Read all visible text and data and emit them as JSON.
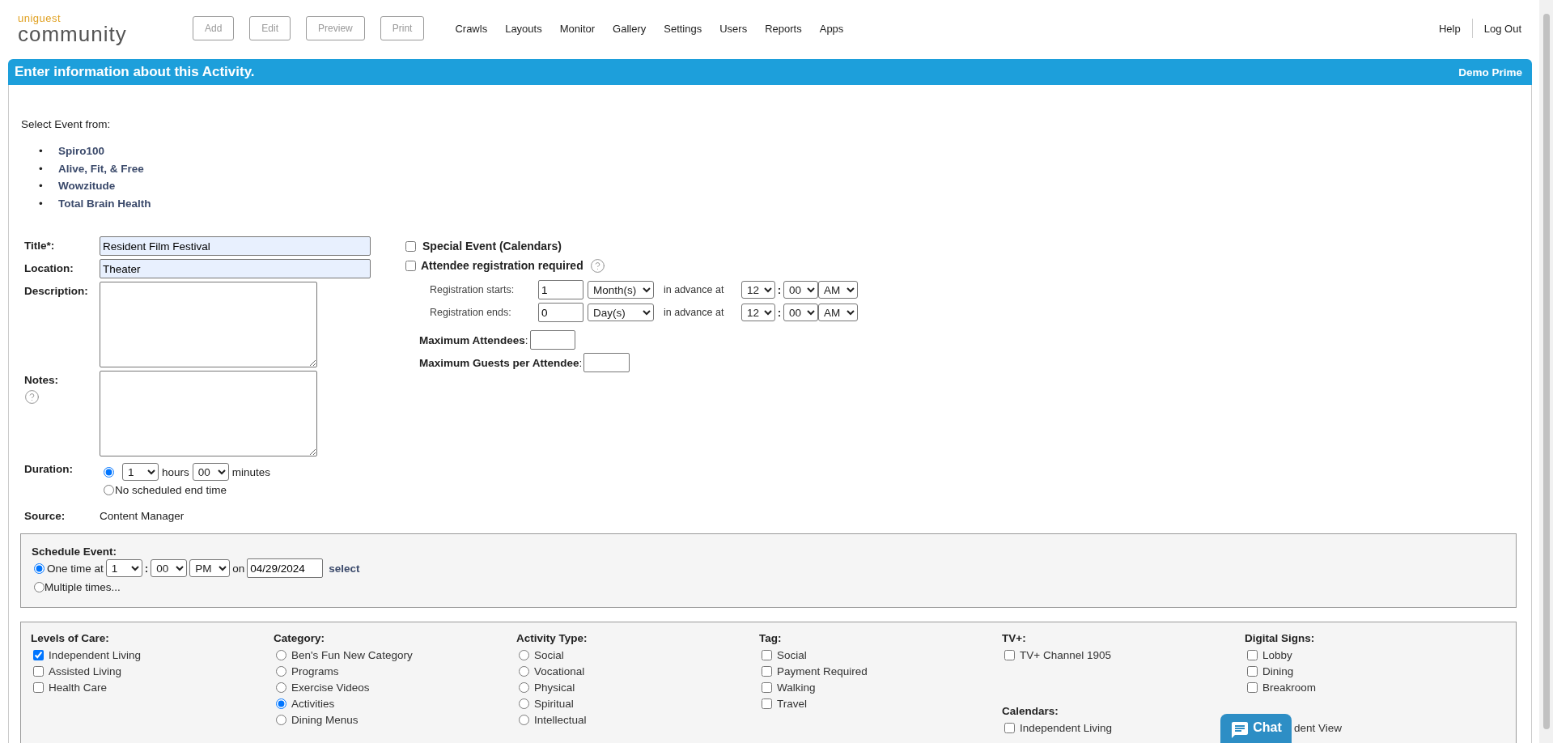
{
  "header": {
    "logo": {
      "top": "uniguest",
      "bottom": "community"
    },
    "actions": [
      {
        "label": "Add",
        "disabled": true
      },
      {
        "label": "Edit",
        "disabled": true
      },
      {
        "label": "Preview",
        "disabled": true
      },
      {
        "label": "Print",
        "disabled": true
      }
    ],
    "nav": [
      "Crawls",
      "Layouts",
      "Monitor",
      "Gallery",
      "Settings",
      "Users",
      "Reports",
      "Apps"
    ],
    "account_links": [
      "Help",
      "Log Out"
    ]
  },
  "banner": {
    "title": "Enter information about this Activity.",
    "account": "Demo Prime"
  },
  "select_event": {
    "label": "Select Event from:",
    "items": [
      {
        "marker": "•",
        "label": "Spiro100"
      },
      {
        "marker": "•",
        "label": "Alive, Fit, & Free"
      },
      {
        "marker": "•",
        "label": "Wowzitude"
      },
      {
        "marker": "•",
        "label": "Total Brain Health"
      }
    ]
  },
  "form": {
    "title": {
      "label": "Title*:",
      "value": "Resident Film Festival"
    },
    "location": {
      "label": "Location:",
      "value": "Theater"
    },
    "description": {
      "label": "Description:"
    },
    "notes": {
      "label": "Notes:"
    },
    "duration": {
      "label": "Duration:",
      "options": [
        {
          "kind": "timed",
          "selected": true,
          "hours": "1",
          "hours_unit": "hours",
          "minutes": "00",
          "minutes_unit": "minutes"
        },
        {
          "kind": "open",
          "selected": false,
          "label": "No scheduled end time"
        }
      ]
    },
    "source": {
      "label": "Source:",
      "value": "Content Manager"
    }
  },
  "registration": {
    "special_event": {
      "label": "Special Event (Calendars)",
      "checked": false
    },
    "required": {
      "label": "Attendee registration required",
      "checked": false
    },
    "rows": [
      {
        "label": "Registration starts:",
        "amount": "1",
        "unit": "Month(s)",
        "advance": "in advance at",
        "hour": "12",
        "separator": ":",
        "minute": "00",
        "meridiem": "AM"
      },
      {
        "label": "Registration ends:",
        "amount": "0",
        "unit": "Day(s)",
        "advance": "in advance at",
        "hour": "12",
        "separator": ":",
        "minute": "00",
        "meridiem": "AM"
      }
    ],
    "max_attendees": {
      "label": "**Maximum Attendees**:"
    },
    "max_guests": {
      "label": "**Maximum Guests per Attendee**:"
    }
  },
  "schedule": {
    "label": "Schedule Event:",
    "options": [
      {
        "kind": "once",
        "selected": true,
        "prefix": "One time at",
        "hour": "1",
        "separator": ":",
        "minute": "00",
        "meridiem": "PM",
        "on": "on",
        "date": "04/29/2024",
        "link": "select"
      },
      {
        "kind": "multiple",
        "selected": false,
        "label": "Multiple times..."
      }
    ]
  },
  "columns": [
    {
      "sections": [
        {
          "title": "Levels of Care:",
          "items": [
            {
              "kind": "checkbox",
              "label": "Independent Living",
              "checked": true
            },
            {
              "kind": "checkbox",
              "label": "Assisted Living",
              "checked": false
            },
            {
              "kind": "checkbox",
              "label": "Health Care",
              "checked": false
            }
          ]
        }
      ]
    },
    {
      "sections": [
        {
          "title": "Category:",
          "items": [
            {
              "kind": "radio",
              "label": "Ben's Fun New Category",
              "selected": false
            },
            {
              "kind": "radio",
              "label": "Programs",
              "selected": false
            },
            {
              "kind": "radio",
              "label": "Exercise Videos",
              "selected": false
            },
            {
              "kind": "radio",
              "label": "Activities",
              "selected": true
            },
            {
              "kind": "radio",
              "label": "Dining Menus",
              "selected": false
            }
          ]
        }
      ]
    },
    {
      "sections": [
        {
          "title": "Activity Type:",
          "items": [
            {
              "kind": "radio",
              "label": "Social",
              "selected": false
            },
            {
              "kind": "radio",
              "label": "Vocational",
              "selected": false
            },
            {
              "kind": "radio",
              "label": "Physical",
              "selected": false
            },
            {
              "kind": "radio",
              "label": "Spiritual",
              "selected": false
            },
            {
              "kind": "radio",
              "label": "Intellectual",
              "selected": false
            }
          ]
        }
      ]
    },
    {
      "sections": [
        {
          "title": "Tag:",
          "items": [
            {
              "kind": "checkbox",
              "label": "Social",
              "checked": false
            },
            {
              "kind": "checkbox",
              "label": "Payment Required",
              "checked": false
            },
            {
              "kind": "checkbox",
              "label": "Walking",
              "checked": false
            },
            {
              "kind": "checkbox",
              "label": "Travel",
              "checked": false
            }
          ]
        }
      ]
    },
    {
      "sections": [
        {
          "title": "TV+:",
          "items": [
            {
              "kind": "checkbox",
              "label": "TV+ Channel 1905",
              "checked": false
            }
          ]
        },
        {
          "title": "Calendars:",
          "items": [
            {
              "kind": "checkbox",
              "label": "Independent Living",
              "checked": false
            }
          ]
        }
      ]
    },
    {
      "sections": [
        {
          "title": "Digital Signs:",
          "items": [
            {
              "kind": "checkbox",
              "label": "Lobby",
              "checked": false
            },
            {
              "kind": "checkbox",
              "label": "Dining",
              "checked": false
            },
            {
              "kind": "checkbox",
              "label": "Breakroom",
              "checked": false
            }
          ]
        },
        {
          "items": [
            {
              "kind": "fragment",
              "label": "dent View"
            }
          ]
        }
      ]
    }
  ],
  "chat": {
    "label": "Chat"
  }
}
